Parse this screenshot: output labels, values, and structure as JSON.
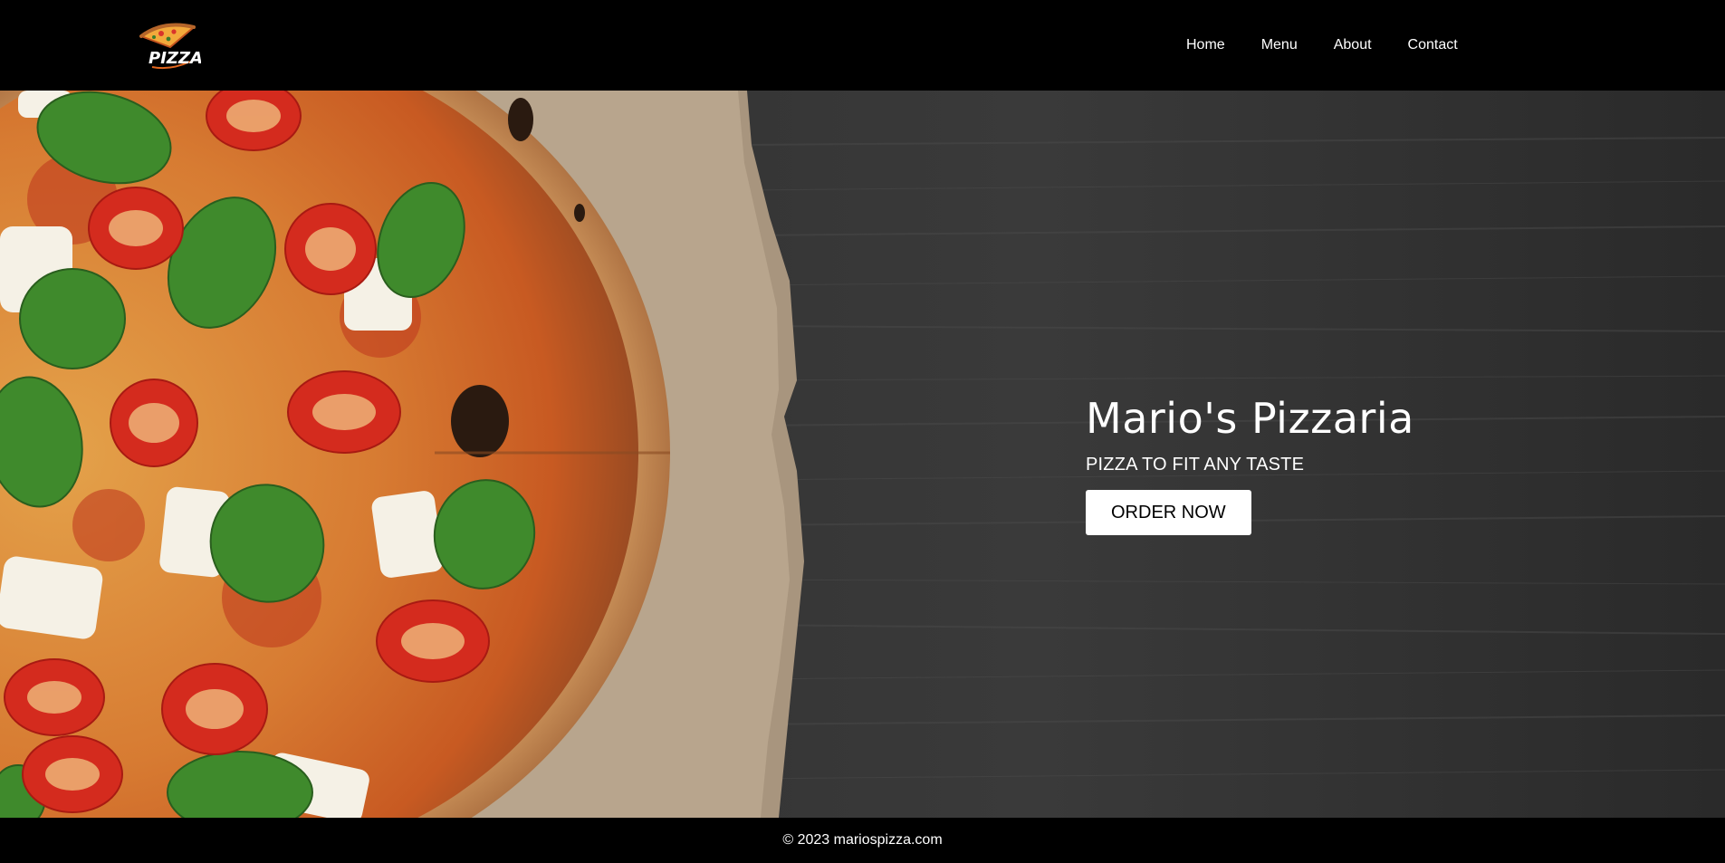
{
  "header": {
    "logo_text": "PIZZA",
    "nav": [
      "Home",
      "Menu",
      "About",
      "Contact"
    ]
  },
  "hero": {
    "title": "Mario's Pizzaria",
    "subtitle": "PIZZA TO FIT ANY TASTE",
    "button_label": "ORDER NOW"
  },
  "footer": {
    "copyright": "© 2023 mariospizza.com"
  },
  "colors": {
    "background": "#000000",
    "text": "#ffffff",
    "wood": "#2e2e2e",
    "button_bg": "#ffffff"
  },
  "icons": {
    "logo": "pizza-slice-icon"
  }
}
